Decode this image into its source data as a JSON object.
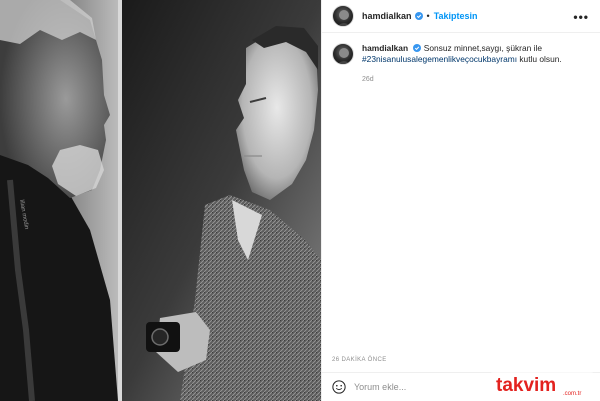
{
  "post": {
    "username": "hamdialkan",
    "dot": "•",
    "follow_state": "Takiptesin",
    "more_icon": "more-options-icon"
  },
  "caption": {
    "username": "hamdialkan",
    "text_1": "Sonsuz minnet,saygı, şükran ile",
    "hashtag": "#23nisanulusalegemenlikveçocukbayramı",
    "text_2": "kutlu olsun.",
    "age": "26d"
  },
  "footer": {
    "time_ago": "26 DAKİKA ÖNCE",
    "comment_placeholder": "Yorum ekle..."
  },
  "watermark": {
    "brand": "takvim",
    "domain": ".com.tr"
  },
  "colors": {
    "link": "#0095f6",
    "hashtag": "#00376b",
    "watermark": "#e3221f"
  }
}
